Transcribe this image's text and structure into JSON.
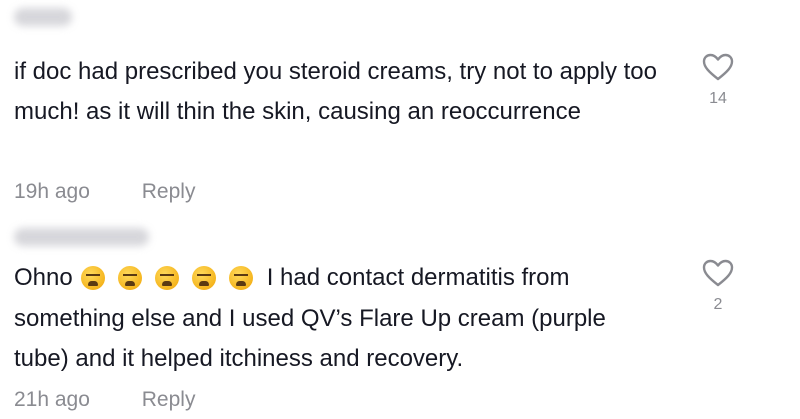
{
  "comments": [
    {
      "text": "if doc had prescribed you steroid creams, try not to apply too much! as it will thin the skin, causing an reoccurrence",
      "time": "19h ago",
      "reply_label": "Reply",
      "likes": "14"
    },
    {
      "prefix": "Ohno",
      "emojis": [
        "tired-face",
        "tired-face",
        "tired-face",
        "tired-face",
        "tired-face"
      ],
      "text": "I had contact dermatitis from something else and I used QV’s Flare Up cream (purple tube) and it helped itchiness and recovery.",
      "time": "21h ago",
      "reply_label": "Reply",
      "likes": "2"
    }
  ],
  "icons": {
    "like": "heart-outline-icon"
  },
  "colors": {
    "text": "#161823",
    "muted": "#8a8b91"
  }
}
